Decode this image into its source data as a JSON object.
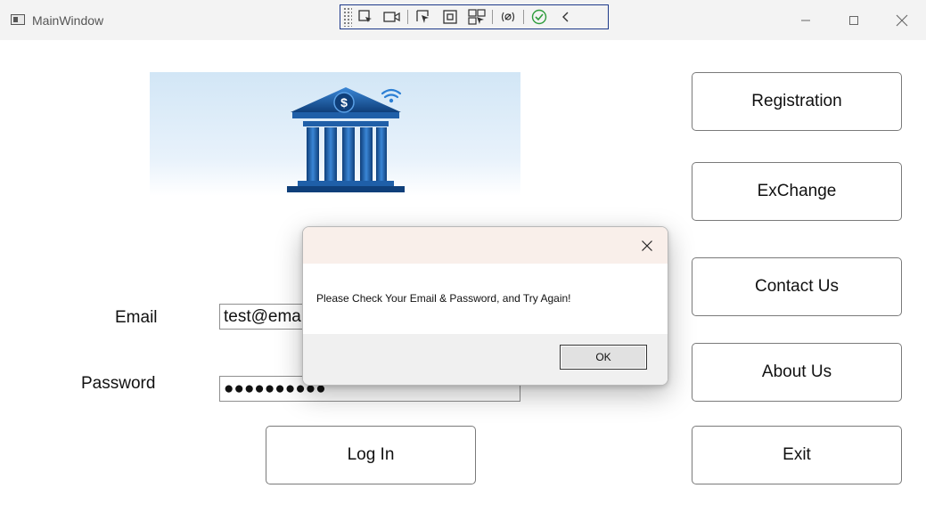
{
  "window": {
    "title": "MainWindow"
  },
  "debug_toolbar": {
    "icons": [
      "select-element-icon",
      "record-icon",
      "select-pointer-icon",
      "display-layout-icon",
      "track-focus-icon",
      "binding-failures-icon",
      "checkmark-icon",
      "collapse-icon"
    ]
  },
  "nav": {
    "registration": "Registration",
    "exchange": "ExChange",
    "contact": "Contact Us",
    "about": "About Us",
    "exit": "Exit"
  },
  "form": {
    "email_label": "Email",
    "email_value": "test@ema",
    "password_label": "Password",
    "password_value": "●●●●●●●●●●",
    "login_label": "Log In"
  },
  "dialog": {
    "message": "Please Check Your Email & Password, and Try Again!",
    "ok_label": "OK"
  },
  "colors": {
    "bank_blue": "#1f5fa8",
    "bank_dark": "#0f3f7a",
    "dialog_title_bg": "#f9efea"
  }
}
